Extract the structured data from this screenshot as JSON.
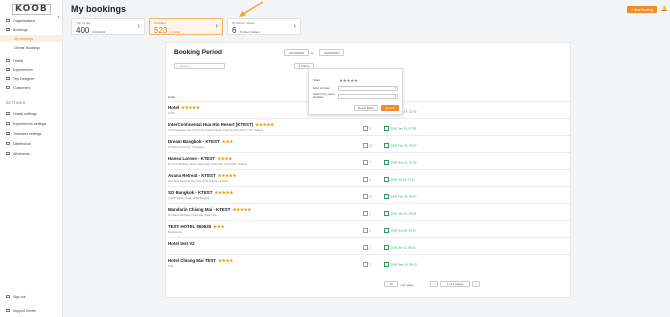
{
  "logo": "KOOB",
  "sidebar": {
    "items": [
      {
        "label": "Organizations",
        "icon": "building-icon"
      },
      {
        "label": "Bookings",
        "icon": "calendar-icon"
      },
      {
        "label": "My bookings"
      },
      {
        "label": "Clients' Bookings"
      },
      {
        "label": "Hotels",
        "icon": "bed-icon"
      },
      {
        "label": "Experiences",
        "icon": "compass-icon"
      },
      {
        "label": "Trip Designer",
        "icon": "map-icon"
      },
      {
        "label": "Customers",
        "icon": "users-icon"
      }
    ],
    "settings_label": "SETTINGS",
    "settings": [
      {
        "label": "Hotels settings",
        "icon": "bed-icon"
      },
      {
        "label": "Experiences settings",
        "icon": "compass-icon"
      },
      {
        "label": "Transfers settings",
        "icon": "car-icon"
      },
      {
        "label": "Distribution",
        "icon": "share-icon"
      },
      {
        "label": "Allotments",
        "icon": "bolt-icon"
      }
    ],
    "signout": "Sign out",
    "support": "Support Center"
  },
  "header": {
    "title": "My bookings",
    "new_booking": "+ New Booking"
  },
  "cards": [
    {
      "label": "Trip by day",
      "num": "400",
      "sub": "10/3/2024"
    },
    {
      "label": "In Folder",
      "num": "523",
      "sub": "in folder"
    },
    {
      "label": "by clients' folders",
      "num": "6",
      "sub": "6 Client folders"
    }
  ],
  "booking_period": {
    "title": "Booking Period",
    "from": "01/03/2024",
    "to_label": "to",
    "to": "31/03/2024"
  },
  "search_placeholder": "Search",
  "filters_label": "Filters",
  "table": {
    "col_hotel": "Hotel",
    "col_last_booking": "Last booking"
  },
  "popup": {
    "stars_label": "Stars",
    "stars": "★★★★★",
    "kind_label": "Kind of hotel",
    "location_label": "Search by name location",
    "reset": "Reset filters",
    "search": "Search"
  },
  "rows": [
    {
      "name": "Hotel",
      "stars": "★★★★★",
      "addr": "ALTIS",
      "count": "1587",
      "date": "2026 Feb 14, 11:30"
    },
    {
      "name": "InterContinental Hua Hin Resort (KTEST)",
      "stars": "★★★★★",
      "addr": "33/33 Phetkasem Rd, Hua Hin Tai, Hua Hin District, Prachuap Khiri Khan 77110, Thailand",
      "count": "3",
      "date": "2026 Jan 30, 07:30"
    },
    {
      "name": "Dream Bangkok - KTEST",
      "stars": "★★★",
      "addr": "10 Sukhumvit Soi 15 - 10 Bangkok",
      "count": "12",
      "date": "2026 Feb 09, 09:57"
    },
    {
      "name": "Hansa Larose - KTEST",
      "stars": "★★★★",
      "addr": "Km 12.5 Old Road, Hansa, Chiang Mai, Chiang Mai, Chiang Mai, Thailand",
      "count": "7",
      "date": "2026 Nov 11, 07:30"
    },
    {
      "name": "Avana Retreat - KTEST",
      "stars": "★★★★★",
      "addr": "Kom Taddi Nai Road, Doi Kong, Sri Mo Manda, Lamphun",
      "count": "3",
      "date": "2024 Jul 19, 07:11"
    },
    {
      "name": "SO Bangkok - KTEST",
      "stars": "★★★★★",
      "addr": "2 North Sathorn Road, 10500 Bangkok",
      "count": "17",
      "date": "2026 Feb 09, 09:57"
    },
    {
      "name": "Mandarin Chiang Mai - KTEST",
      "stars": "★★★★★",
      "addr": "28 Chiang Mai Road, Chiang Mai, Chiang Rai",
      "count": "1",
      "date": "2026 Jan 16, 08:18"
    },
    {
      "name": "TEST HOTEL 050625",
      "stars": "★★★",
      "addr": "Bangkok City",
      "count": "3",
      "date": "2025 Jun 05, 09:57"
    },
    {
      "name": "Hotel test V2",
      "stars": "",
      "addr": "",
      "count": "2",
      "date": "2026 Jun 11, 09:11"
    },
    {
      "name": "Hotel Chiang Mai TEST",
      "stars": "★★★★",
      "addr": "Krabi",
      "count": "2",
      "date": "2026 Sep 19, 09:13"
    }
  ],
  "pagination": {
    "per_page": "10",
    "per_page_label": "/ per page",
    "prev": "<",
    "page": "1 of 2 pages",
    "next": ">"
  }
}
